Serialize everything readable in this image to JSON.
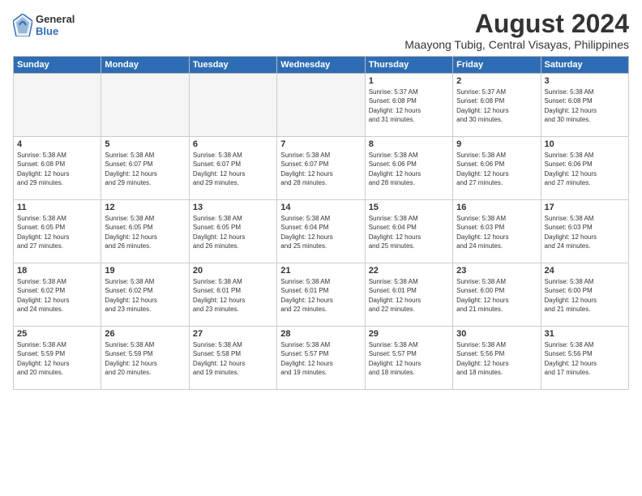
{
  "header": {
    "logo": {
      "general": "General",
      "blue": "Blue"
    },
    "title": "August 2024",
    "location": "Maayong Tubig, Central Visayas, Philippines"
  },
  "calendar": {
    "weekdays": [
      "Sunday",
      "Monday",
      "Tuesday",
      "Wednesday",
      "Thursday",
      "Friday",
      "Saturday"
    ],
    "weeks": [
      [
        {
          "day": "",
          "info": ""
        },
        {
          "day": "",
          "info": ""
        },
        {
          "day": "",
          "info": ""
        },
        {
          "day": "",
          "info": ""
        },
        {
          "day": "1",
          "info": "Sunrise: 5:37 AM\nSunset: 6:08 PM\nDaylight: 12 hours\nand 31 minutes."
        },
        {
          "day": "2",
          "info": "Sunrise: 5:37 AM\nSunset: 6:08 PM\nDaylight: 12 hours\nand 30 minutes."
        },
        {
          "day": "3",
          "info": "Sunrise: 5:38 AM\nSunset: 6:08 PM\nDaylight: 12 hours\nand 30 minutes."
        }
      ],
      [
        {
          "day": "4",
          "info": "Sunrise: 5:38 AM\nSunset: 6:08 PM\nDaylight: 12 hours\nand 29 minutes."
        },
        {
          "day": "5",
          "info": "Sunrise: 5:38 AM\nSunset: 6:07 PM\nDaylight: 12 hours\nand 29 minutes."
        },
        {
          "day": "6",
          "info": "Sunrise: 5:38 AM\nSunset: 6:07 PM\nDaylight: 12 hours\nand 29 minutes."
        },
        {
          "day": "7",
          "info": "Sunrise: 5:38 AM\nSunset: 6:07 PM\nDaylight: 12 hours\nand 28 minutes."
        },
        {
          "day": "8",
          "info": "Sunrise: 5:38 AM\nSunset: 6:06 PM\nDaylight: 12 hours\nand 28 minutes."
        },
        {
          "day": "9",
          "info": "Sunrise: 5:38 AM\nSunset: 6:06 PM\nDaylight: 12 hours\nand 27 minutes."
        },
        {
          "day": "10",
          "info": "Sunrise: 5:38 AM\nSunset: 6:06 PM\nDaylight: 12 hours\nand 27 minutes."
        }
      ],
      [
        {
          "day": "11",
          "info": "Sunrise: 5:38 AM\nSunset: 6:05 PM\nDaylight: 12 hours\nand 27 minutes."
        },
        {
          "day": "12",
          "info": "Sunrise: 5:38 AM\nSunset: 6:05 PM\nDaylight: 12 hours\nand 26 minutes."
        },
        {
          "day": "13",
          "info": "Sunrise: 5:38 AM\nSunset: 6:05 PM\nDaylight: 12 hours\nand 26 minutes."
        },
        {
          "day": "14",
          "info": "Sunrise: 5:38 AM\nSunset: 6:04 PM\nDaylight: 12 hours\nand 25 minutes."
        },
        {
          "day": "15",
          "info": "Sunrise: 5:38 AM\nSunset: 6:04 PM\nDaylight: 12 hours\nand 25 minutes."
        },
        {
          "day": "16",
          "info": "Sunrise: 5:38 AM\nSunset: 6:03 PM\nDaylight: 12 hours\nand 24 minutes."
        },
        {
          "day": "17",
          "info": "Sunrise: 5:38 AM\nSunset: 6:03 PM\nDaylight: 12 hours\nand 24 minutes."
        }
      ],
      [
        {
          "day": "18",
          "info": "Sunrise: 5:38 AM\nSunset: 6:02 PM\nDaylight: 12 hours\nand 24 minutes."
        },
        {
          "day": "19",
          "info": "Sunrise: 5:38 AM\nSunset: 6:02 PM\nDaylight: 12 hours\nand 23 minutes."
        },
        {
          "day": "20",
          "info": "Sunrise: 5:38 AM\nSunset: 6:01 PM\nDaylight: 12 hours\nand 23 minutes."
        },
        {
          "day": "21",
          "info": "Sunrise: 5:38 AM\nSunset: 6:01 PM\nDaylight: 12 hours\nand 22 minutes."
        },
        {
          "day": "22",
          "info": "Sunrise: 5:38 AM\nSunset: 6:01 PM\nDaylight: 12 hours\nand 22 minutes."
        },
        {
          "day": "23",
          "info": "Sunrise: 5:38 AM\nSunset: 6:00 PM\nDaylight: 12 hours\nand 21 minutes."
        },
        {
          "day": "24",
          "info": "Sunrise: 5:38 AM\nSunset: 6:00 PM\nDaylight: 12 hours\nand 21 minutes."
        }
      ],
      [
        {
          "day": "25",
          "info": "Sunrise: 5:38 AM\nSunset: 5:59 PM\nDaylight: 12 hours\nand 20 minutes."
        },
        {
          "day": "26",
          "info": "Sunrise: 5:38 AM\nSunset: 5:59 PM\nDaylight: 12 hours\nand 20 minutes."
        },
        {
          "day": "27",
          "info": "Sunrise: 5:38 AM\nSunset: 5:58 PM\nDaylight: 12 hours\nand 19 minutes."
        },
        {
          "day": "28",
          "info": "Sunrise: 5:38 AM\nSunset: 5:57 PM\nDaylight: 12 hours\nand 19 minutes."
        },
        {
          "day": "29",
          "info": "Sunrise: 5:38 AM\nSunset: 5:57 PM\nDaylight: 12 hours\nand 18 minutes."
        },
        {
          "day": "30",
          "info": "Sunrise: 5:38 AM\nSunset: 5:56 PM\nDaylight: 12 hours\nand 18 minutes."
        },
        {
          "day": "31",
          "info": "Sunrise: 5:38 AM\nSunset: 5:56 PM\nDaylight: 12 hours\nand 17 minutes."
        }
      ]
    ]
  }
}
